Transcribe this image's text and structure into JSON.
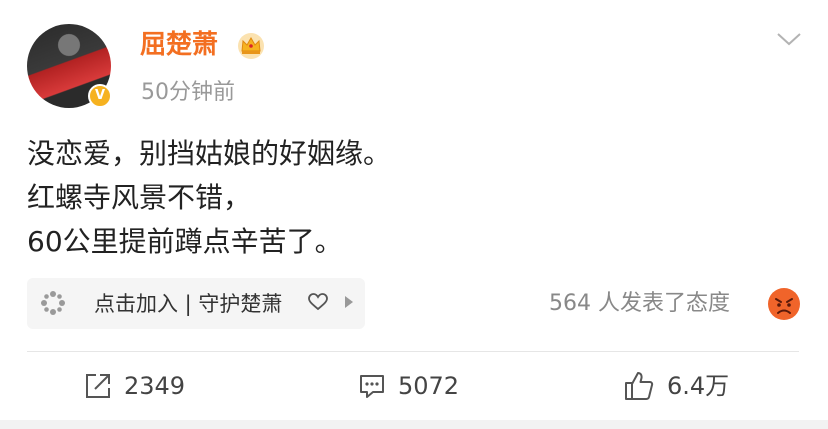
{
  "post": {
    "author": {
      "name": "屈楚萧",
      "verified_badge": "V"
    },
    "timestamp": "50分钟前",
    "content": {
      "line1": "没恋爱，别挡姑娘的好姻缘。",
      "line2": "红螺寺风景不错，",
      "line3": "60公里提前蹲点辛苦了。"
    },
    "fan_pill": {
      "label": "点击加入 | 守护楚萧"
    },
    "reactions": {
      "text": "564 人发表了态度"
    },
    "actions": {
      "repost_count": "2349",
      "comment_count": "5072",
      "like_count": "6.4万"
    }
  },
  "colors": {
    "username": "#f36f21",
    "verified_badge": "#f6b220",
    "crown": "#f6b220",
    "emoji": "#f0642a"
  },
  "icons": [
    "chevron-down-icon",
    "crown-icon",
    "sparkle-icon",
    "heart-icon",
    "play-arrow-icon",
    "angry-face-icon",
    "repost-icon",
    "comment-icon",
    "like-icon"
  ]
}
